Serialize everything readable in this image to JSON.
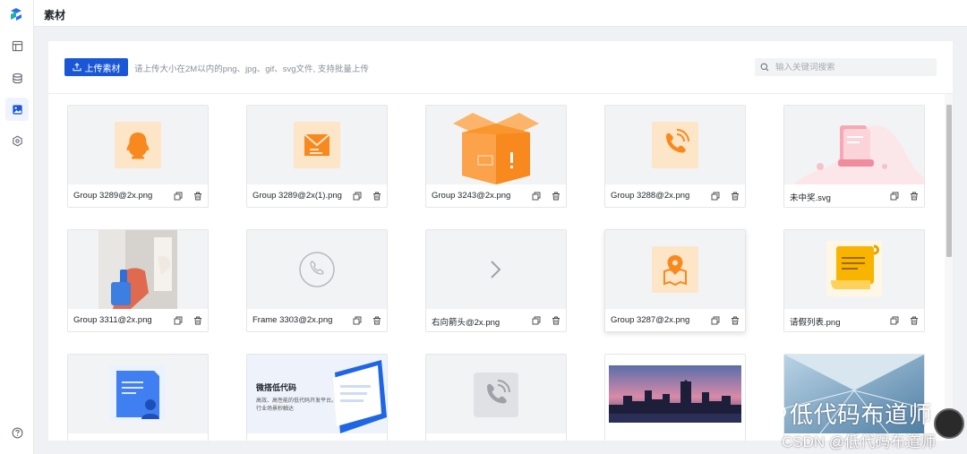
{
  "header": {
    "title": "素材"
  },
  "sidebar": {
    "items": [
      {
        "icon": "layout-icon"
      },
      {
        "icon": "database-icon"
      },
      {
        "icon": "image-icon",
        "active": true
      },
      {
        "icon": "settings-icon"
      }
    ],
    "help_icon": "help-icon"
  },
  "toolbar": {
    "upload_label": "上传素材",
    "hint": "请上传大小在2M以内的png、jpg、gif、svg文件, 支持批量上传",
    "search_placeholder": "输入关键词搜索",
    "search_value": ""
  },
  "accent_color": "#1a57d6",
  "assets": [
    {
      "name": "Group 3289@2x.png",
      "thumb": "qq-icon"
    },
    {
      "name": "Group 3289@2x(1).png",
      "thumb": "mail-icon"
    },
    {
      "name": "Group 3243@2x.png",
      "thumb": "box-illustration"
    },
    {
      "name": "Group 3288@2x.png",
      "thumb": "phone-icon"
    },
    {
      "name": "未中奖.svg",
      "thumb": "no-prize-illustration"
    },
    {
      "name": "Group 3311@2x.png",
      "thumb": "cleaning-photo"
    },
    {
      "name": "Frame 3303@2x.png",
      "thumb": "phone-outline-icon"
    },
    {
      "name": "右向箭头@2x.png",
      "thumb": "arrow-right-icon"
    },
    {
      "name": "Group 3287@2x.png",
      "thumb": "map-pin-icon"
    },
    {
      "name": "请假列表.png",
      "thumb": "scroll-icon"
    },
    {
      "name": "",
      "thumb": "document-user-icon"
    },
    {
      "name": "",
      "thumb": "banner-image",
      "banner_title": "微搭低代码",
      "banner_line1": "高效、高性能的低代码开发平台。",
      "banner_line2": "行业场景秒触达"
    },
    {
      "name": "",
      "thumb": "phone-gray-icon"
    },
    {
      "name": "",
      "thumb": "city-skyline-photo"
    },
    {
      "name": "",
      "thumb": "building-photo"
    }
  ],
  "watermark": {
    "brand": "低代码布道师",
    "csdn": "CSDN @低代码布道师"
  }
}
